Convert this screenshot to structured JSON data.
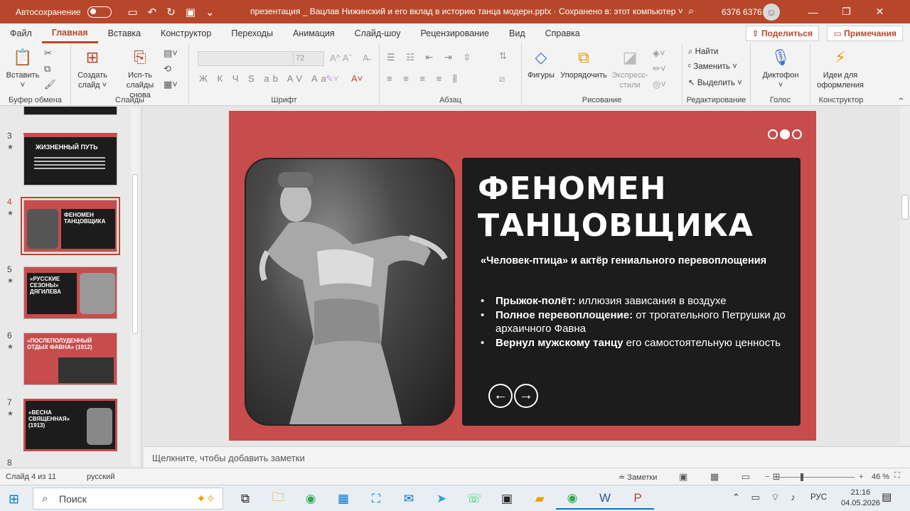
{
  "titlebar": {
    "autosave_label": "Автосохранение",
    "doc_title": "презентация _ Вацлав Нижинский и его вклад в историю танца модерн.pptx  ·  Сохранено в: этот компьютер  ˅",
    "user": "6376 6376",
    "window_minimize": "—",
    "window_restore": "❐",
    "window_close": "✕"
  },
  "tabs": [
    "Файл",
    "Главная",
    "Вставка",
    "Конструктор",
    "Переходы",
    "Анимация",
    "Слайд-шоу",
    "Рецензирование",
    "Вид",
    "Справка"
  ],
  "share_label": "Поделиться",
  "notes_label": "Примечания",
  "ribbon": {
    "paste": "Вставить",
    "clipboard_group": "Буфер обмена",
    "new_slide": "Создать слайд",
    "reuse_slides": "Исп-ть слайды снова",
    "slides_group": "Слайды",
    "font_size": "72",
    "font_group": "Шрифт",
    "paragraph_group": "Абзац",
    "shapes": "Фигуры",
    "arrange": "Упорядочить",
    "quick_styles": "Экспресс-стили",
    "drawing_group": "Рисование",
    "find": "Найти",
    "replace": "Заменить",
    "select": "Выделить",
    "editing_group": "Редактирование",
    "dictate": "Диктофон",
    "voice_group": "Голос",
    "designer": "Идеи для оформления",
    "designer_group": "Конструктор"
  },
  "thumbnails": [
    {
      "num": "3",
      "title": "ЖИЗНЕННЫЙ ПУТЬ"
    },
    {
      "num": "4",
      "title": "ФЕНОМЕН ТАНЦОВЩИКА"
    },
    {
      "num": "5",
      "title": "«РУССКИЕ СЕЗОНЫ» ДЯГИЛЕВА"
    },
    {
      "num": "6",
      "title": "«ПОСЛЕПОЛУДЕННЫЙ ОТДЫХ ФАВНА» (1912)"
    },
    {
      "num": "7",
      "title": "«ВЕСНА СВЯЩЕННАЯ» (1913)"
    },
    {
      "num": "8",
      "title": ""
    }
  ],
  "slide": {
    "title": "ФЕНОМЕН ТАНЦОВЩИКА",
    "subtitle": "«Человек-птица» и актёр гениального перевоплощения",
    "bullets": [
      {
        "bold": "Прыжок-полёт:",
        "text": " иллюзия зависания в воздухе"
      },
      {
        "bold": "Полное перевоплощение:",
        "text": " от трогательного Петрушки до архаичного Фавна"
      },
      {
        "bold": "Вернул мужскому танцу",
        "text": " его самостоятельную ценность"
      }
    ],
    "arrow_left": "←",
    "arrow_right": "→",
    "bg_color": "#c74c4c",
    "card_color": "#1c1c1c"
  },
  "notes_placeholder": "Щелкните, чтобы добавить заметки",
  "status": {
    "slide_info": "Слайд 4 из 11",
    "language": "русский",
    "notes_button": "≐ Заметки",
    "zoom_minus": "−",
    "zoom": "46 %"
  },
  "taskbar": {
    "search_placeholder": "Поиск",
    "lang": "РУС",
    "time": "21:16",
    "date": "04.05.2026"
  },
  "accent_color": "#b7472a"
}
